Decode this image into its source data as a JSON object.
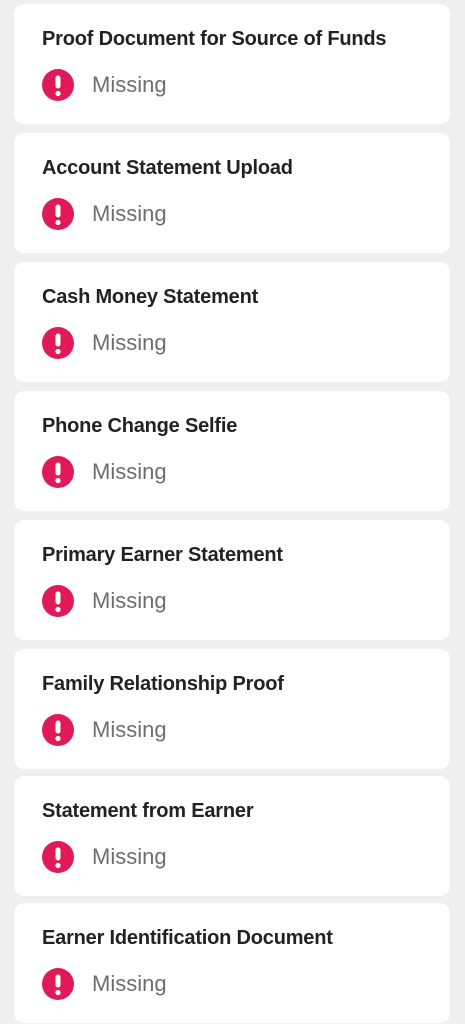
{
  "colors": {
    "background": "#efefef",
    "card": "#ffffff",
    "alert": "#e01a59",
    "title_text": "#222222",
    "status_text": "#6e6e6e"
  },
  "documents": [
    {
      "title": "Proof Document for Source of Funds",
      "status": "Missing",
      "status_icon": "alert-exclamation-icon"
    },
    {
      "title": "Account Statement Upload",
      "status": "Missing",
      "status_icon": "alert-exclamation-icon"
    },
    {
      "title": "Cash Money Statement",
      "status": "Missing",
      "status_icon": "alert-exclamation-icon"
    },
    {
      "title": "Phone Change Selfie",
      "status": "Missing",
      "status_icon": "alert-exclamation-icon"
    },
    {
      "title": "Primary Earner Statement",
      "status": "Missing",
      "status_icon": "alert-exclamation-icon"
    },
    {
      "title": "Family Relationship Proof",
      "status": "Missing",
      "status_icon": "alert-exclamation-icon"
    },
    {
      "title": "Statement from Earner",
      "status": "Missing",
      "status_icon": "alert-exclamation-icon"
    },
    {
      "title": "Earner Identification Document",
      "status": "Missing",
      "status_icon": "alert-exclamation-icon"
    }
  ]
}
